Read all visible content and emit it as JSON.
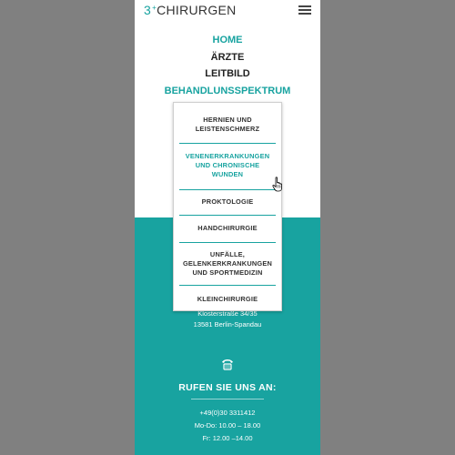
{
  "logo": {
    "number": "3",
    "superscript": "+",
    "name": "CHIRURGEN"
  },
  "nav": {
    "items": [
      {
        "label": "HOME",
        "active": true
      },
      {
        "label": "ÄRZTE",
        "active": false
      },
      {
        "label": "LEITBILD",
        "active": false
      },
      {
        "label": "BEHANDLUNSSPEKTRUM",
        "active": true
      }
    ]
  },
  "dropdown": {
    "items": [
      {
        "lines": [
          "HERNIEN UND",
          "LEISTENSCHMERZ"
        ],
        "highlighted": false
      },
      {
        "lines": [
          "VENENERKRANKUNGEN",
          "UND CHRONISCHE",
          "WUNDEN"
        ],
        "highlighted": true
      },
      {
        "lines": [
          "PROKTOLOGIE"
        ],
        "highlighted": false
      },
      {
        "lines": [
          "HANDCHIRURGIE"
        ],
        "highlighted": false
      },
      {
        "lines": [
          "UNFÄLLE,",
          "GELENKERKRANKUNGEN",
          "UND SPORTMEDIZIN"
        ],
        "highlighted": false
      },
      {
        "lines": [
          "KLEINCHIRURGIE"
        ],
        "highlighted": false
      }
    ]
  },
  "address": {
    "street": "Klosterstraße 34/35",
    "city": "13581 Berlin-Spandau"
  },
  "contact": {
    "title": "RUFEN SIE UNS AN:",
    "phone": "+49(0)30 3311412",
    "hours_weekday": "Mo-Do: 10.00 – 18.00",
    "hours_friday": "Fr: 12.00 –14.00"
  },
  "colors": {
    "accent": "#18a3a0",
    "backdrop": "#808080"
  }
}
